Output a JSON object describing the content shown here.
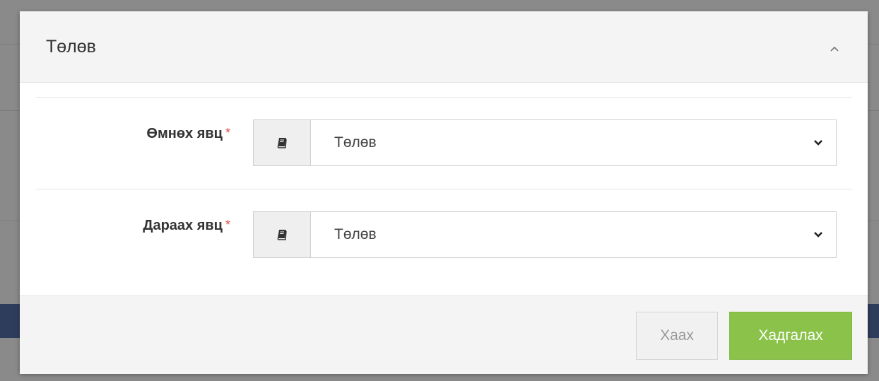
{
  "modal": {
    "title": "Төлөв"
  },
  "form": {
    "fields": [
      {
        "label": "Өмнөх явц",
        "required_mark": "*",
        "value": "Төлөв"
      },
      {
        "label": "Дараах явц",
        "required_mark": "*",
        "value": "Төлөв"
      }
    ]
  },
  "footer": {
    "close_label": "Хаах",
    "save_label": "Хадгалах"
  },
  "colors": {
    "save_button": "#8bc34a",
    "required": "#e0504c"
  },
  "icons": {
    "collapse": "chevron-up-icon",
    "addon": "book-icon",
    "select_arrow": "chevron-down-icon"
  }
}
